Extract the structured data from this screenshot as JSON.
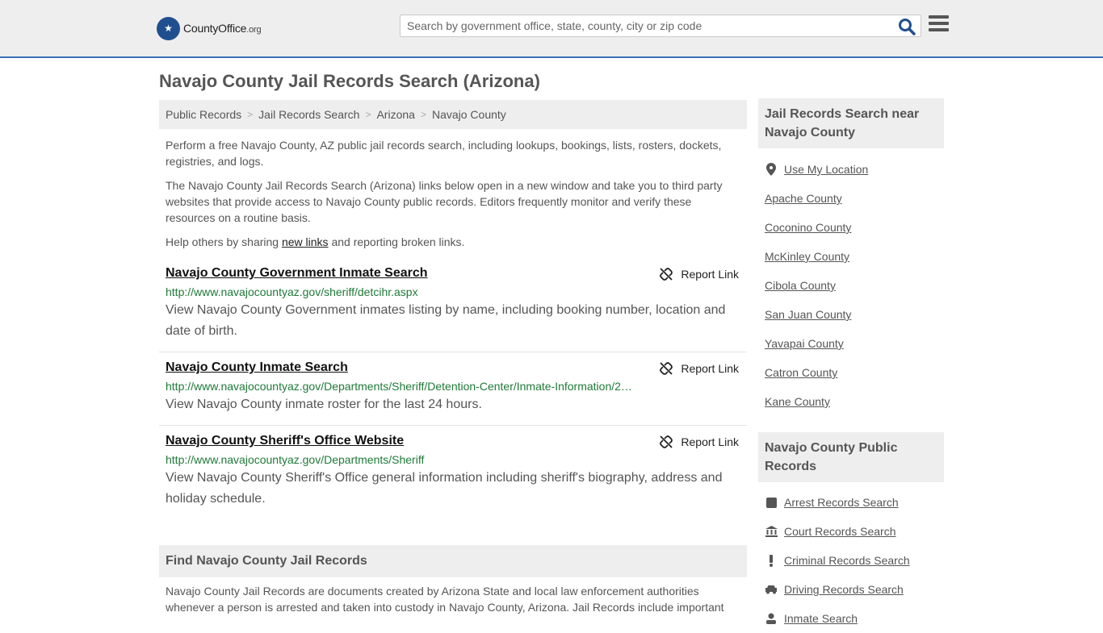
{
  "header": {
    "logo_text": "CountyOffice",
    "logo_suffix": ".org",
    "search_placeholder": "Search by government office, state, county, city or zip code"
  },
  "page": {
    "title": "Navajo County Jail Records Search (Arizona)"
  },
  "breadcrumb": [
    "Public Records",
    "Jail Records Search",
    "Arizona",
    "Navajo County"
  ],
  "intro": {
    "p1": "Perform a free Navajo County, AZ public jail records search, including lookups, bookings, lists, rosters, dockets, registries, and logs.",
    "p2": "The Navajo County Jail Records Search (Arizona) links below open in a new window and take you to third party websites that provide access to Navajo County public records. Editors frequently monitor and verify these resources on a routine basis.",
    "p3_before": "Help others by sharing ",
    "p3_link": "new links",
    "p3_after": " and reporting broken links."
  },
  "report_label": "Report Link",
  "results": [
    {
      "title": "Navajo County Government Inmate Search",
      "url": "http://www.navajocountyaz.gov/sheriff/detcihr.aspx",
      "desc": "View Navajo County Government inmates listing by name, including booking number, location and date of birth."
    },
    {
      "title": "Navajo County Inmate Search",
      "url": "http://www.navajocountyaz.gov/Departments/Sheriff/Detention-Center/Inmate-Information/2…",
      "desc": "View Navajo County inmate roster for the last 24 hours."
    },
    {
      "title": "Navajo County Sheriff's Office Website",
      "url": "http://www.navajocountyaz.gov/Departments/Sheriff",
      "desc": "View Navajo County Sheriff's Office general information including sheriff's biography, address and holiday schedule."
    }
  ],
  "find_section": {
    "title": "Find Navajo County Jail Records",
    "body": "Navajo County Jail Records are documents created by Arizona State and local law enforcement authorities whenever a person is arrested and taken into custody in Navajo County, Arizona. Jail Records include important"
  },
  "sidebar": {
    "nearby_title": "Jail Records Search near Navajo County",
    "use_location": "Use My Location",
    "nearby": [
      "Apache County",
      "Coconino County",
      "McKinley County",
      "Cibola County",
      "San Juan County",
      "Yavapai County",
      "Catron County",
      "Kane County"
    ],
    "public_records_title": "Navajo County Public Records",
    "public_records": [
      {
        "label": "Arrest Records Search",
        "icon": "square-icon"
      },
      {
        "label": "Court Records Search",
        "icon": "courthouse-icon"
      },
      {
        "label": "Criminal Records Search",
        "icon": "exclamation-icon"
      },
      {
        "label": "Driving Records Search",
        "icon": "car-icon"
      },
      {
        "label": "Inmate Search",
        "icon": "inmate-icon"
      }
    ]
  }
}
